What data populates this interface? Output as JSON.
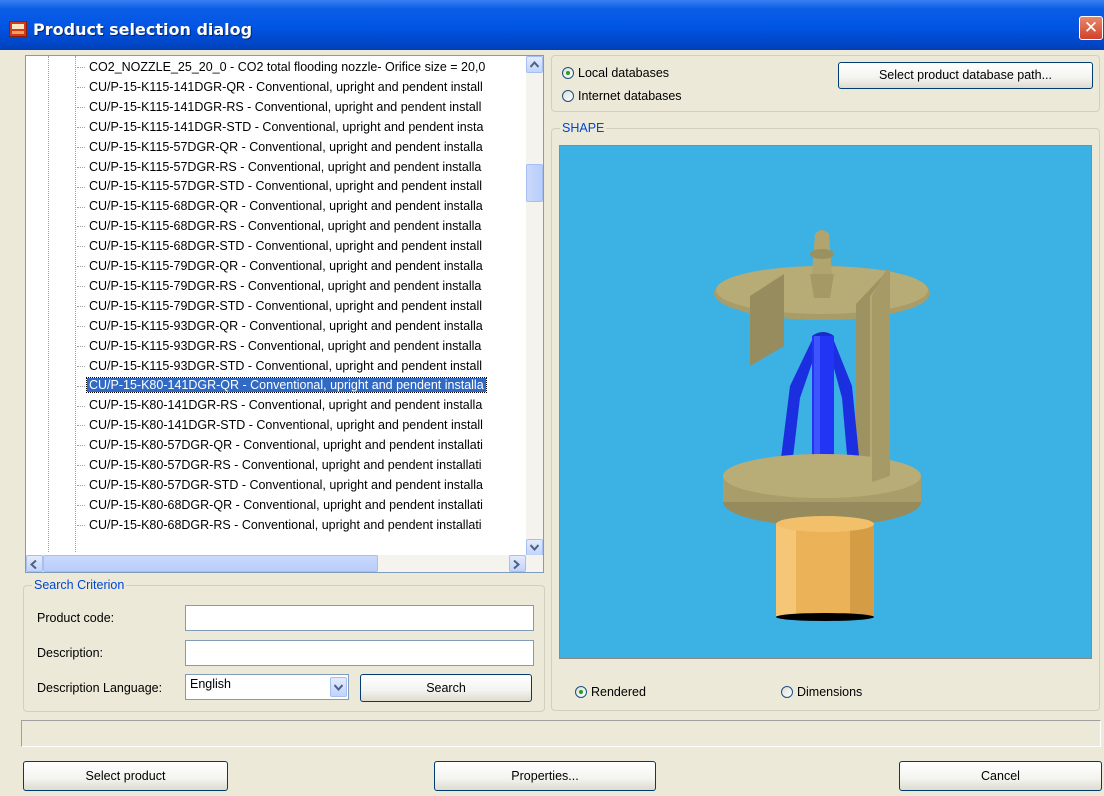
{
  "window": {
    "title": "Product selection dialog",
    "close_glyph": "✕"
  },
  "tree": {
    "items": [
      "CO2_NOZZLE_25_20_0 - CO2 total flooding nozzle- Orifice size = 20,0",
      "CU/P-15-K115-141DGR-QR - Conventional, upright and pendent install",
      "CU/P-15-K115-141DGR-RS - Conventional, upright and pendent install",
      "CU/P-15-K115-141DGR-STD - Conventional, upright and pendent insta",
      "CU/P-15-K115-57DGR-QR - Conventional, upright and pendent installa",
      "CU/P-15-K115-57DGR-RS - Conventional, upright and pendent installa",
      "CU/P-15-K115-57DGR-STD - Conventional, upright and pendent install",
      "CU/P-15-K115-68DGR-QR - Conventional, upright and pendent installa",
      "CU/P-15-K115-68DGR-RS - Conventional, upright and pendent installa",
      "CU/P-15-K115-68DGR-STD - Conventional, upright and pendent install",
      "CU/P-15-K115-79DGR-QR - Conventional, upright and pendent installa",
      "CU/P-15-K115-79DGR-RS - Conventional, upright and pendent installa",
      "CU/P-15-K115-79DGR-STD - Conventional, upright and pendent install",
      "CU/P-15-K115-93DGR-QR - Conventional, upright and pendent installa",
      "CU/P-15-K115-93DGR-RS - Conventional, upright and pendent installa",
      "CU/P-15-K115-93DGR-STD - Conventional, upright and pendent install",
      "CU/P-15-K80-141DGR-QR - Conventional, upright and pendent installa",
      "CU/P-15-K80-141DGR-RS - Conventional, upright and pendent installa",
      "CU/P-15-K80-141DGR-STD - Conventional, upright and pendent install",
      "CU/P-15-K80-57DGR-QR - Conventional, upright and pendent installati",
      "CU/P-15-K80-57DGR-RS - Conventional, upright and pendent installati",
      "CU/P-15-K80-57DGR-STD - Conventional, upright and pendent installa",
      "CU/P-15-K80-68DGR-QR - Conventional, upright and pendent installati",
      "CU/P-15-K80-68DGR-RS - Conventional, upright and pendent installati"
    ],
    "selected_index": 16
  },
  "search": {
    "legend": "Search Criterion",
    "product_code_label": "Product code:",
    "product_code_value": "",
    "description_label": "Description:",
    "description_value": "",
    "language_label": "Description Language:",
    "language_value": "English",
    "search_button": "Search"
  },
  "database": {
    "local_label": "Local databases",
    "internet_label": "Internet databases",
    "selected": "local",
    "path_button": "Select product database path..."
  },
  "shape": {
    "legend": "SHAPE",
    "rendered_label": "Rendered",
    "dimensions_label": "Dimensions",
    "selected": "rendered",
    "background_color": "#3cb1e3"
  },
  "buttons": {
    "select_product": "Select product",
    "properties": "Properties...",
    "cancel": "Cancel"
  }
}
